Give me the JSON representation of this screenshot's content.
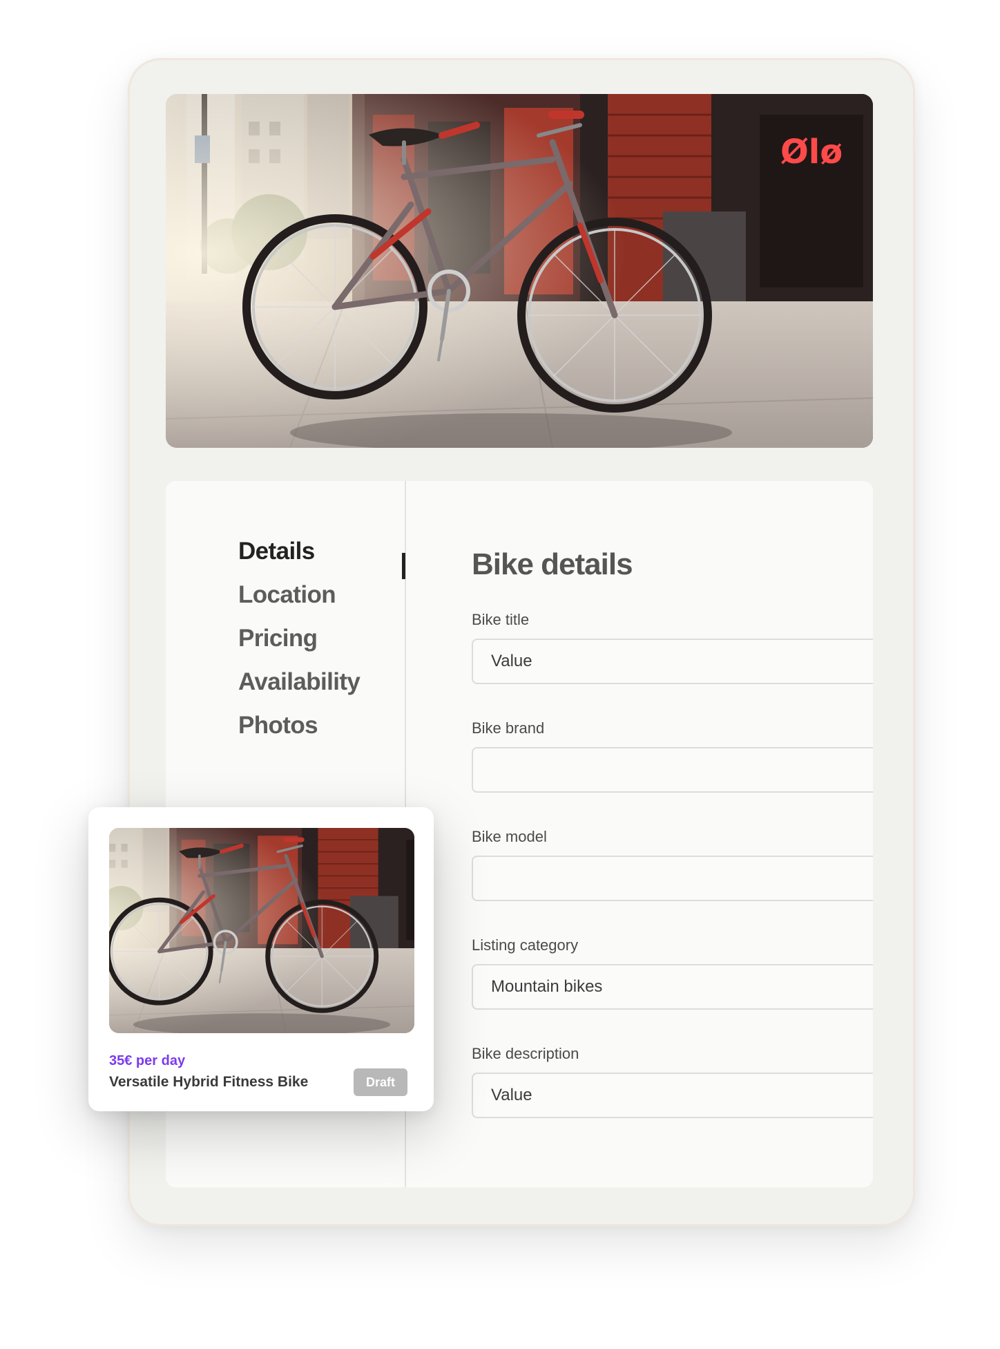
{
  "nav": {
    "items": [
      {
        "label": "Details",
        "active": true
      },
      {
        "label": "Location",
        "active": false
      },
      {
        "label": "Pricing",
        "active": false
      },
      {
        "label": "Availability",
        "active": false
      },
      {
        "label": "Photos",
        "active": false
      }
    ]
  },
  "form": {
    "title": "Bike details",
    "fields": [
      {
        "label": "Bike title",
        "value": "Value"
      },
      {
        "label": "Bike brand",
        "value": ""
      },
      {
        "label": "Bike model",
        "value": ""
      },
      {
        "label": "Listing category",
        "value": "Mountain bikes"
      },
      {
        "label": "Bike description",
        "value": "Value"
      }
    ]
  },
  "preview": {
    "price": "35€ per day",
    "name": "Versatile Hybrid Fitness Bike",
    "status": "Draft"
  },
  "colors": {
    "accent": "#7c3aed",
    "bike_frame": "#7a6a6c",
    "bike_accent": "#c0362c",
    "badge_bg": "#b8b8b8"
  }
}
